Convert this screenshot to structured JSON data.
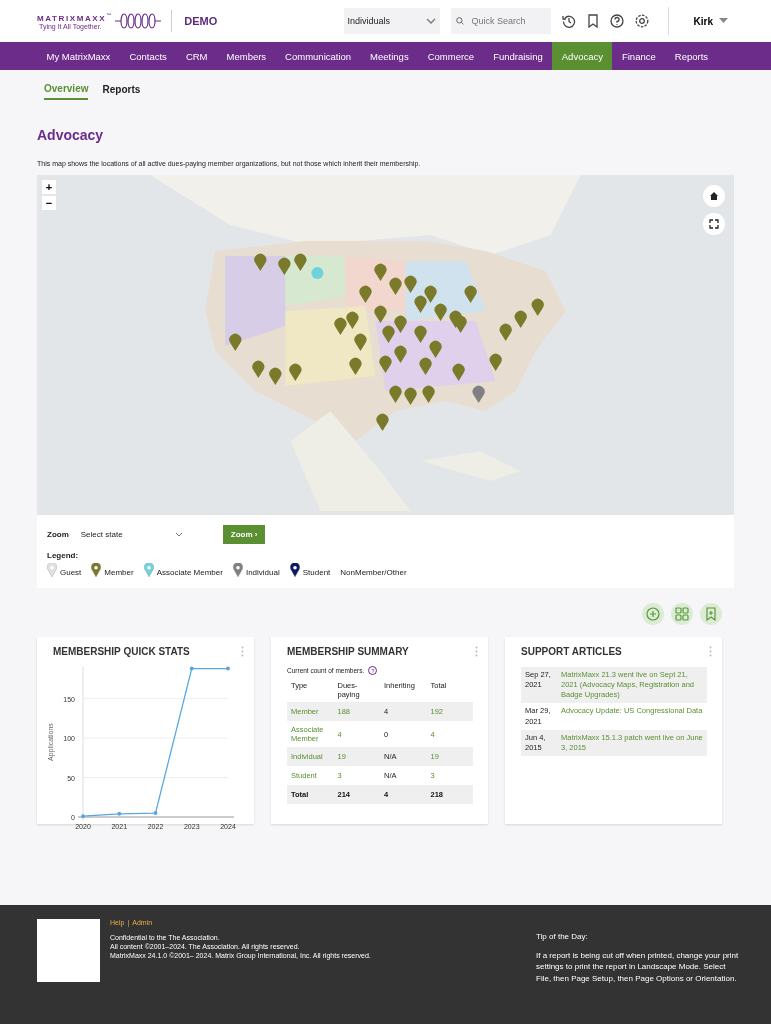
{
  "header": {
    "logo": {
      "name": "MATRIXMAXX",
      "tm": "™",
      "tagline": "Tying It All Together."
    },
    "site": "DEMO",
    "dropdown": {
      "value": "Individuals"
    },
    "search": {
      "placeholder": "Quick Search"
    },
    "user": "Kirk"
  },
  "nav": [
    {
      "label": "My MatrixMaxx",
      "selected": false
    },
    {
      "label": "Contacts",
      "selected": false
    },
    {
      "label": "CRM",
      "selected": false
    },
    {
      "label": "Members",
      "selected": false
    },
    {
      "label": "Communication",
      "selected": false
    },
    {
      "label": "Meetings",
      "selected": false
    },
    {
      "label": "Commerce",
      "selected": false
    },
    {
      "label": "Fundraising",
      "selected": false
    },
    {
      "label": "Advocacy",
      "selected": true
    },
    {
      "label": "Finance",
      "selected": false
    },
    {
      "label": "Reports",
      "selected": false
    }
  ],
  "subtabs": [
    {
      "label": "Overview",
      "selected": true
    },
    {
      "label": "Reports",
      "selected": false
    }
  ],
  "page": {
    "title": "Advocacy",
    "description": "This map shows the locations of all active dues-paying member organizations, but not those which inherit their membership."
  },
  "map": {
    "kind": "picture",
    "zoom_in": "+",
    "zoom_out": "−"
  },
  "zoom": {
    "label": "Zoom",
    "placeholder": "Select state",
    "button": "Zoom ›"
  },
  "legend": {
    "title": "Legend:",
    "items": [
      {
        "label": "Guest",
        "color": "#e0e0e0"
      },
      {
        "label": "Member",
        "color": "#7a7a2a"
      },
      {
        "label": "Associate Member",
        "color": "#6fd3dc"
      },
      {
        "label": "Individual",
        "color": "#808080"
      },
      {
        "label": "Student",
        "color": "#0b1a66"
      },
      {
        "label": "NonMember/Other"
      }
    ]
  },
  "quick_stats": {
    "title": "MEMBERSHIP QUICK STATS",
    "chart_data": {
      "type": "line",
      "ylabel": "Applications",
      "categories": [
        "2020",
        "2021",
        "2022",
        "2023",
        "2024"
      ],
      "series": [
        {
          "color": "#5aa7e0",
          "values": [
            1,
            4,
            5,
            188,
            188
          ]
        }
      ],
      "ylim": [
        0,
        190
      ],
      "yticks": [
        0,
        50,
        100,
        150
      ],
      "grid": true
    }
  },
  "summary": {
    "title": "MEMBERSHIP SUMMARY",
    "note": "Current count of members.",
    "help": "?",
    "columns": [
      "Type",
      "Dues-paying",
      "Inheriting",
      "Total"
    ],
    "rows": [
      [
        "Member",
        "188",
        "4",
        "192"
      ],
      [
        "Associate Member",
        "4",
        "0",
        "4"
      ],
      [
        "Individual",
        "19",
        "N/A",
        "19"
      ],
      [
        "Student",
        "3",
        "N/A",
        "3"
      ]
    ],
    "total": [
      "Total",
      "214",
      "4",
      "218"
    ]
  },
  "articles": {
    "title": "SUPPORT ARTICLES",
    "items": [
      {
        "date": "Sep 27, 2021",
        "title": "MatrixMaxx 21.3 went live on Sept 21, 2021 (Advocacy Maps, Registration and Badge Upgrades)"
      },
      {
        "date": "Mar 29, 2021",
        "title": "Advocacy Update: US Congressional Data"
      },
      {
        "date": "Jun 4, 2015",
        "title": "MatrixMaxx 15.1.3 patch went live on June 3, 2015"
      }
    ]
  },
  "footer": {
    "links": [
      "Help",
      "Admin"
    ],
    "separator": "|",
    "lines": [
      "Confidential to the The Association.",
      "All content ©2001–2024. The Association. All rights reserved.",
      "MatrixMaxx 24.1.0 ©2001– 2024. Matrix Group International, Inc. All rights reserved."
    ],
    "tip_title": "Tip of the Day:",
    "tip": "If a report is being cut off when printed, change your print settings to print the report in Landscape Mode. Select File, then Page Setup, then Page Options or Orientation."
  }
}
